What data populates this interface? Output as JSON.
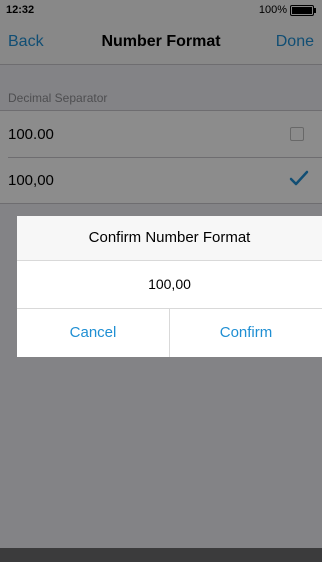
{
  "status": {
    "time": "12:32",
    "battery": "100%"
  },
  "nav": {
    "back": "Back",
    "title": "Number Format",
    "done": "Done"
  },
  "section": {
    "header": "Decimal Separator"
  },
  "options": [
    {
      "label": "100.00",
      "selected": false
    },
    {
      "label": "100,00",
      "selected": true
    }
  ],
  "dialog": {
    "title": "Confirm Number Format",
    "message": "100,00",
    "cancel": "Cancel",
    "confirm": "Confirm"
  },
  "colors": {
    "accent": "#1f8fd3"
  }
}
